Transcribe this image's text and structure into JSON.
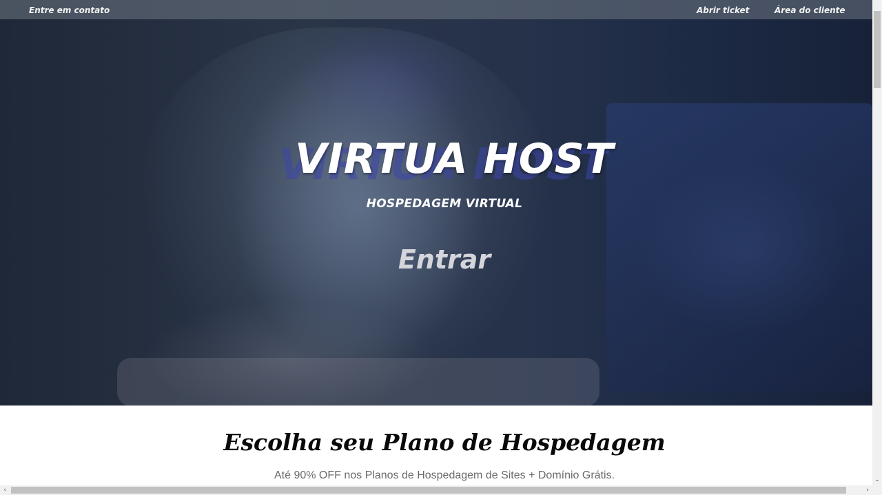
{
  "topbar": {
    "contact_label": "Entre em contato",
    "ticket_label": "Abrir ticket",
    "client_area_label": "Área do cliente"
  },
  "hero": {
    "brand": "VIRTUA HOST",
    "subtitle": "HOSPEDAGEM VIRTUAL",
    "cta_label": "Entrar"
  },
  "plans": {
    "title": "Escolha seu Plano de Hospedagem",
    "subtitle": "Até 90% OFF nos Planos de Hospedagem de Sites + Domínio Grátis."
  },
  "scrollbars": {
    "left_arrow": "‹",
    "right_arrow": "›",
    "down_arrow": "⌄"
  },
  "colors": {
    "hero_overlay": "#1f2a40",
    "brand_red": "#b9283c",
    "text_white": "#ffffff"
  }
}
